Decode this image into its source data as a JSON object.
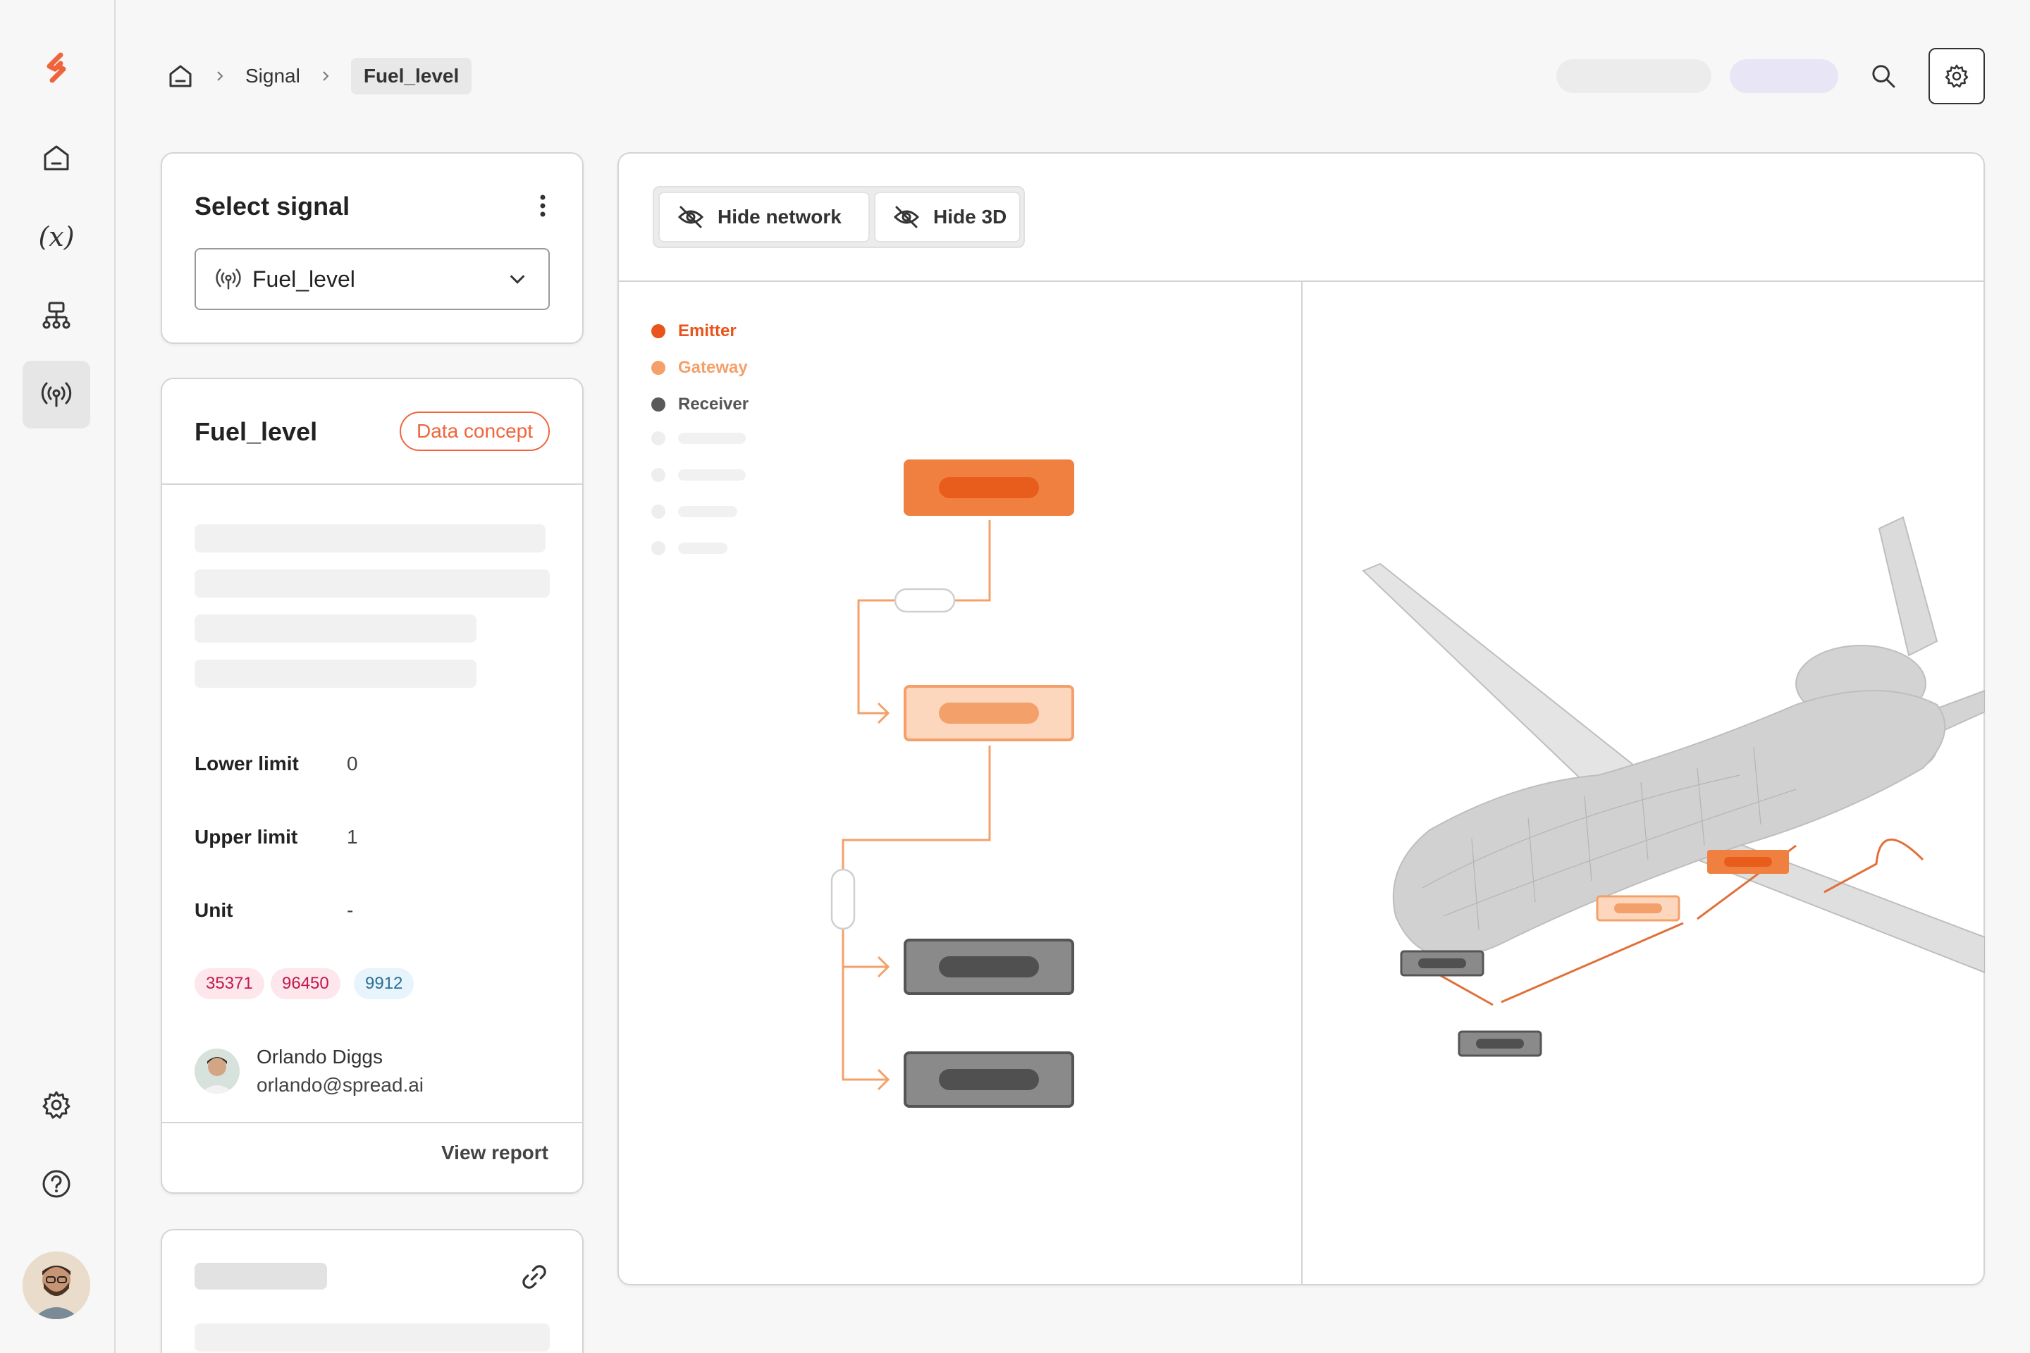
{
  "colors": {
    "brand": "#f0643c",
    "emitter": "#e8541c",
    "gateway": "#f4a06a",
    "receiver": "#5a5a5a",
    "tag_red_bg": "#fde7ec",
    "tag_red_fg": "#c2184d",
    "tag_blue_bg": "#e7f4fb",
    "tag_blue_fg": "#2a6f97"
  },
  "sidebar": {
    "items": [
      {
        "icon": "home-icon"
      },
      {
        "icon": "variable-icon",
        "label": "(x)"
      },
      {
        "icon": "network-tree-icon"
      },
      {
        "icon": "signal-broadcast-icon",
        "active": true
      }
    ],
    "bottom": [
      {
        "icon": "gear-icon"
      },
      {
        "icon": "help-icon"
      }
    ]
  },
  "header": {
    "breadcrumbs": [
      "Signal",
      "Fuel_level"
    ],
    "icons": [
      "home-icon",
      "search-icon",
      "gear-icon"
    ]
  },
  "select_signal": {
    "title": "Select signal",
    "selected": "Fuel_level"
  },
  "signal_detail": {
    "name": "Fuel_level",
    "badge": "Data concept",
    "lower_limit_label": "Lower limit",
    "lower_limit": "0",
    "upper_limit_label": "Upper limit",
    "upper_limit": "1",
    "unit_label": "Unit",
    "unit": "-",
    "tags": [
      "35371",
      "96450",
      "9912"
    ],
    "owner_name": "Orlando Diggs",
    "owner_email": "orlando@spread.ai",
    "view_report": "View report"
  },
  "main": {
    "hide_network": "Hide network",
    "hide_3d": "Hide 3D",
    "legend": [
      "Emitter",
      "Gateway",
      "Receiver"
    ]
  }
}
